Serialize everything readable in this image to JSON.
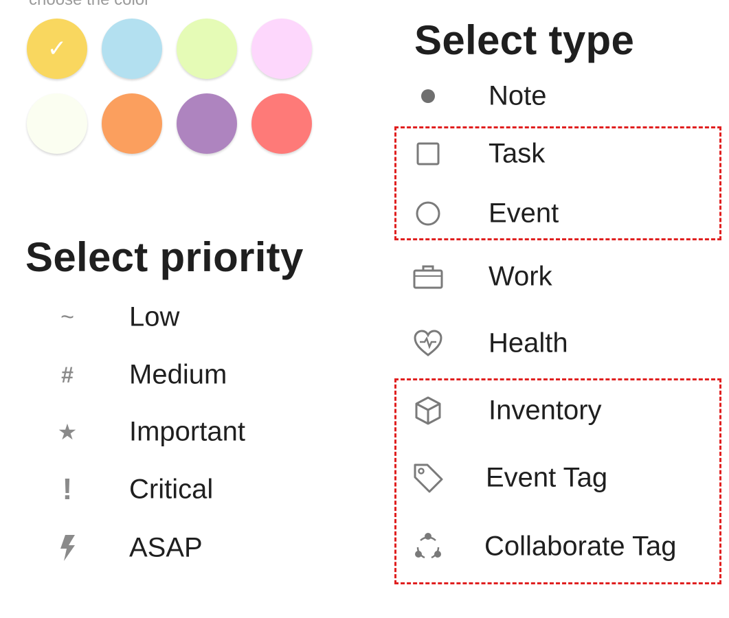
{
  "colors": {
    "caption": "choose the color",
    "swatches": [
      {
        "name": "yellow",
        "hex": "#F9D75F",
        "selected": true,
        "check": "✓"
      },
      {
        "name": "light-blue",
        "hex": "#B3E0F0",
        "selected": false
      },
      {
        "name": "light-green",
        "hex": "#E5FBB6",
        "selected": false
      },
      {
        "name": "pink",
        "hex": "#FDD7FC",
        "selected": false
      },
      {
        "name": "off-white",
        "hex": "#FBFEF1",
        "selected": false
      },
      {
        "name": "orange",
        "hex": "#FB9F5E",
        "selected": false
      },
      {
        "name": "purple",
        "hex": "#AE84BF",
        "selected": false
      },
      {
        "name": "red",
        "hex": "#FE7A78",
        "selected": false
      }
    ]
  },
  "priority": {
    "title": "Select priority",
    "items": [
      {
        "label": "Low",
        "icon": "tilde-icon",
        "glyph": "~"
      },
      {
        "label": "Medium",
        "icon": "hash-icon",
        "glyph": "#"
      },
      {
        "label": "Important",
        "icon": "star-icon",
        "glyph": "★"
      },
      {
        "label": "Critical",
        "icon": "exclamation-icon",
        "glyph": "!"
      },
      {
        "label": "ASAP",
        "icon": "lightning-icon",
        "glyph": "ϟ"
      }
    ]
  },
  "type": {
    "title": "Select type",
    "items": [
      {
        "label": "Note",
        "icon": "dot-icon"
      },
      {
        "label": "Task",
        "icon": "square-icon"
      },
      {
        "label": "Event",
        "icon": "circle-icon"
      },
      {
        "label": "Work",
        "icon": "briefcase-icon"
      },
      {
        "label": "Health",
        "icon": "heart-pulse-icon"
      },
      {
        "label": "Inventory",
        "icon": "box-icon"
      },
      {
        "label": "Event Tag",
        "icon": "tag-icon"
      },
      {
        "label": "Collaborate Tag",
        "icon": "collaborate-icon"
      }
    ]
  },
  "highlight_color": "#E02020"
}
